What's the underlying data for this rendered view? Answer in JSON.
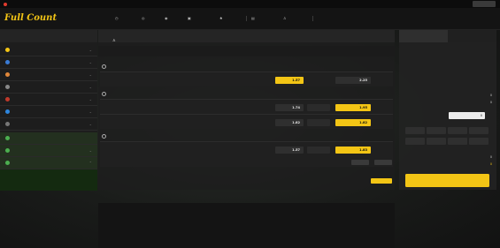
{
  "notice": {
    "text": "",
    "right_links": [
      "",
      "",
      "",
      ""
    ],
    "button": ""
  },
  "header": {
    "logo": "Full Count",
    "nav": [
      {
        "icon": "clock-icon",
        "label": "",
        "x": 0
      },
      {
        "icon": "ball-icon",
        "label": ""
      },
      {
        "icon": "play-icon",
        "label": ""
      },
      {
        "icon": "game-icon",
        "label": ""
      },
      {
        "icon": "casino-icon",
        "label": ""
      },
      {
        "icon": "result-icon",
        "label": ""
      },
      {
        "icon": "user-icon",
        "label": ""
      }
    ],
    "right_links": [
      "",
      "",
      ""
    ],
    "user_text": "",
    "points_text": ""
  },
  "sidebar": {
    "title": "",
    "items": [
      {
        "label": "",
        "color": "#f3c515"
      },
      {
        "label": "",
        "color": "#3a7bd5"
      },
      {
        "label": "",
        "color": "#e0873a"
      },
      {
        "label": "",
        "color": "#888888"
      },
      {
        "label": "",
        "color": "#c0392b"
      },
      {
        "label": "",
        "color": "#2e86de"
      },
      {
        "label": "",
        "color": "#777777"
      }
    ],
    "green_items": [
      {
        "label": ""
      },
      {
        "label": ""
      },
      {
        "label": ""
      }
    ],
    "sub_items": [
      "",
      ""
    ]
  },
  "center": {
    "title": "",
    "slip_header": {
      "date": "",
      "score": "",
      "c1": "",
      "c2": "",
      "c3": "",
      "c4": "",
      "c5": ""
    },
    "leagues": [
      {
        "title": "",
        "matches": [
          {
            "time": "",
            "home": "",
            "away": "",
            "state": "",
            "market": "",
            "odds_left": {
              "label": "",
              "value": "1.57",
              "selected": true
            },
            "odds_right": {
              "label": "",
              "value": "2.25",
              "selected": false
            },
            "more": ""
          }
        ]
      },
      {
        "title": "",
        "matches": [
          {
            "time": "",
            "home": "",
            "away": "",
            "state": "",
            "market": "",
            "odds_left": {
              "label": "",
              "value": "1.74",
              "selected": false
            },
            "mid": "",
            "odds_right": {
              "label": "",
              "value": "1.95",
              "selected": true
            },
            "more": ""
          },
          {
            "time": "",
            "home": "",
            "away": "",
            "state": "",
            "market": "",
            "odds_left": {
              "label": "",
              "value": "1.82",
              "selected": false
            },
            "mid": "",
            "odds_right": {
              "label": "",
              "value": "1.82",
              "selected": true
            },
            "more": ""
          }
        ]
      },
      {
        "title": "",
        "matches": [
          {
            "time": "",
            "home": "",
            "away": "",
            "state": "",
            "market": "",
            "odds_left": {
              "label": "",
              "value": "1.57",
              "selected": false
            },
            "mid": "",
            "odds_right": {
              "label": "",
              "value": "1.83",
              "selected": true
            },
            "more": ""
          }
        ]
      }
    ],
    "row_buttons": [
      "",
      ""
    ],
    "bottom_button": ""
  },
  "slip": {
    "tab_active": "",
    "tab_inactive": "",
    "lines": [
      {
        "label": "",
        "value": "0"
      },
      {
        "label": "",
        "value": "0"
      }
    ],
    "amount_label": "",
    "amount_value": "0",
    "amount_unit": "",
    "quick_amounts": [
      "",
      "",
      "",
      "",
      "",
      "",
      "",
      ""
    ],
    "win_label": "",
    "win_value": "0",
    "final_label": "",
    "final_value": "0",
    "submit": ""
  },
  "footer": {
    "cols": [
      {
        "title": "",
        "items": [
          "",
          "",
          ""
        ]
      },
      {
        "title": "",
        "items": [
          "",
          "",
          ""
        ]
      },
      {
        "title": "",
        "items": [
          "",
          "",
          ""
        ]
      },
      {
        "title": "",
        "items": [
          "",
          "",
          ""
        ]
      }
    ]
  }
}
